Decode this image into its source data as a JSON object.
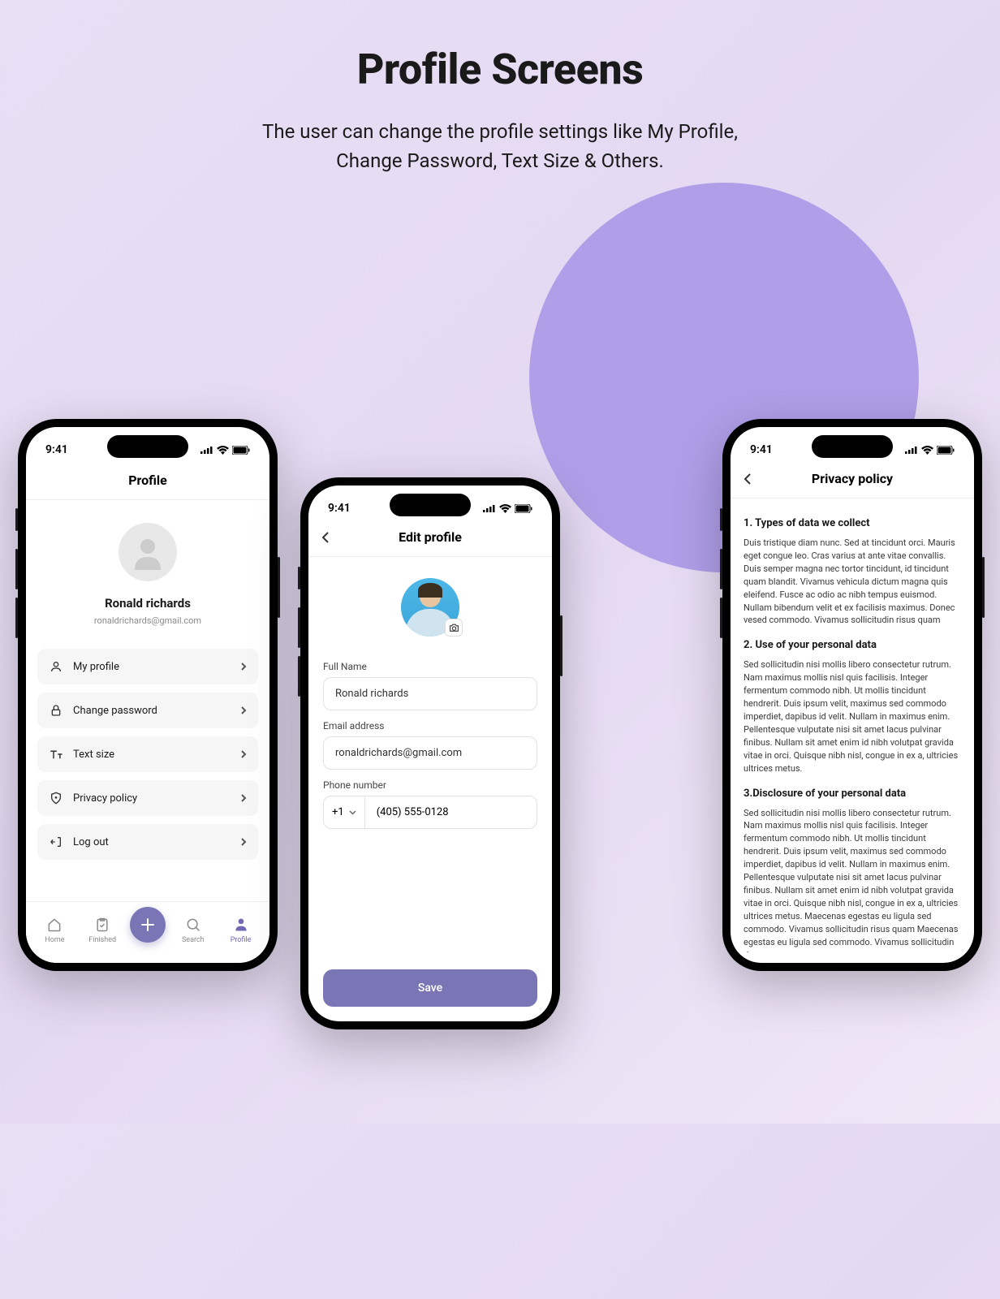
{
  "header": {
    "title": "Profile Screens",
    "subtitle_line1": "The user can change the profile settings like My Profile,",
    "subtitle_line2": "Change Password, Text Size & Others."
  },
  "status": {
    "time": "9:41"
  },
  "phone1": {
    "title": "Profile",
    "user_name": "Ronald richards",
    "user_email": "ronaldrichards@gmail.com",
    "menu": [
      {
        "label": "My profile"
      },
      {
        "label": "Change password"
      },
      {
        "label": "Text size"
      },
      {
        "label": "Privacy policy"
      },
      {
        "label": "Log out"
      }
    ],
    "nav": {
      "home": "Home",
      "finished": "Finished",
      "search": "Search",
      "profile": "Profile"
    }
  },
  "phone2": {
    "title": "Edit profile",
    "labels": {
      "full_name": "Full Name",
      "email": "Email address",
      "phone": "Phone number"
    },
    "values": {
      "full_name": "Ronald richards",
      "email": "ronaldrichards@gmail.com",
      "country_code": "+1",
      "phone": "(405) 555-0128"
    },
    "save": "Save"
  },
  "phone3": {
    "title": "Privacy policy",
    "sections": [
      {
        "heading": "1. Types of data we collect",
        "body": "Duis tristique diam nunc. Sed at tincidunt orci. Mauris eget congue leo. Cras varius at ante vitae convallis. Duis semper magna nec tortor tincidunt, id tincidunt quam blandit. Vivamus vehicula dictum magna quis eleifend. Fusce ac odio ac nibh tempus euismod. Nullam bibendum velit et ex facilisis maximus. Donec vesed commodo. Vivamus sollicitudin risus quam"
      },
      {
        "heading": "2. Use of your personal data",
        "body": "Sed sollicitudin nisi mollis libero consectetur rutrum. Nam maximus mollis nisl quis facilisis. Integer fermentum commodo nibh. Ut mollis tincidunt hendrerit. Duis ipsum velit, maximus sed commodo imperdiet, dapibus id velit. Nullam in maximus enim. Pellentesque vulputate nisi sit amet lacus pulvinar finibus. Nullam sit amet enim id nibh volutpat gravida vitae in orci. Quisque nibh nisl, congue in ex a, ultricies ultrices metus."
      },
      {
        "heading": "3.Disclosure of your personal data",
        "body": "Sed sollicitudin nisi mollis libero consectetur rutrum. Nam maximus mollis nisl quis facilisis. Integer fermentum commodo nibh. Ut mollis tincidunt hendrerit. Duis ipsum velit, maximus sed commodo imperdiet, dapibus id velit. Nullam in maximus enim. Pellentesque vulputate nisi sit amet lacus pulvinar finibus. Nullam sit amet enim id nibh volutpat gravida vitae in orci. Quisque nibh nisl, congue in ex a, ultricies ultrices metus. Maecenas egestas eu ligula sed commodo. Vivamus sollicitudin risus quam Maecenas egestas eu ligula sed commodo. Vivamus sollicitudin risus quam"
      }
    ]
  }
}
